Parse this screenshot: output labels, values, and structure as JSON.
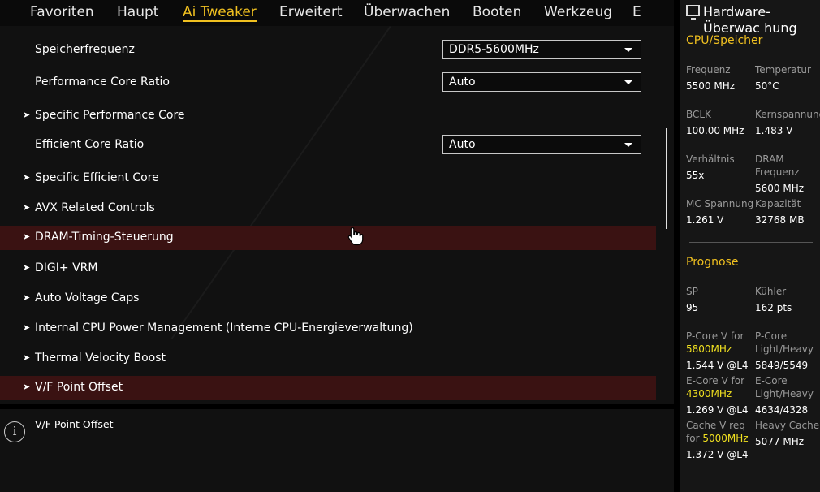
{
  "tabs": [
    {
      "label": "Favoriten"
    },
    {
      "label": "Haupt"
    },
    {
      "label": "Ai Tweaker"
    },
    {
      "label": "Erweitert"
    },
    {
      "label": "Überwachen"
    },
    {
      "label": "Booten"
    },
    {
      "label": "Werkzeug"
    },
    {
      "label": "E"
    }
  ],
  "active_tab": "Ai Tweaker",
  "settings": {
    "memory_freq": {
      "label": "Speicherfrequenz",
      "value": "DDR5-5600MHz"
    },
    "perf_core_ratio": {
      "label": "Performance Core Ratio",
      "value": "Auto"
    },
    "specific_perf_core": {
      "label": "Specific Performance Core"
    },
    "eff_core_ratio": {
      "label": "Efficient Core Ratio",
      "value": "Auto"
    },
    "specific_eff_core": {
      "label": "Specific Efficient Core"
    },
    "avx": {
      "label": "AVX Related Controls"
    },
    "dram_timing": {
      "label": "DRAM-Timing-Steuerung"
    },
    "digi_vrm": {
      "label": "DIGI+ VRM"
    },
    "auto_voltage_caps": {
      "label": "Auto Voltage Caps"
    },
    "internal_cpu_pm": {
      "label": "Internal CPU Power Management (Interne CPU-Energieverwaltung)"
    },
    "thermal_velocity": {
      "label": "Thermal Velocity Boost"
    },
    "vf_point_offset": {
      "label": "V/F Point Offset"
    }
  },
  "help": {
    "text": "V/F Point Offset",
    "icon": "info-icon"
  },
  "hw_monitor": {
    "title": "Hardware-Überwac hung",
    "cpu_mem": {
      "heading": "CPU/Speicher",
      "freq_label": "Frequenz",
      "freq_value": "5500 MHz",
      "temp_label": "Temperatur",
      "temp_value": "50°C",
      "bclk_label": "BCLK",
      "bclk_value": "100.00 MHz",
      "core_v_label": "Kernspannung",
      "core_v_value": "1.483 V",
      "ratio_label": "Verhältnis",
      "ratio_value": "55x",
      "dram_freq_label1": "DRAM",
      "dram_freq_label2": "Frequenz",
      "dram_freq_value": "5600 MHz",
      "mc_v_label": "MC Spannung",
      "mc_v_value": "1.261 V",
      "capacity_label": "Kapazität",
      "capacity_value": "32768 MB"
    },
    "prognose": {
      "heading": "Prognose",
      "sp_label": "SP",
      "sp_value": "95",
      "cooler_label": "Kühler",
      "cooler_value": "162 pts",
      "pcore_v_label": "P-Core V for",
      "pcore_v_freq": "5800MHz",
      "pcore_v_value": "1.544 V @L4",
      "pcore_lh_label1": "P-Core",
      "pcore_lh_label2": "Light/Heavy",
      "pcore_lh_value": "5849/5549",
      "ecore_v_label": "E-Core V for",
      "ecore_v_freq": "4300MHz",
      "ecore_v_value": "1.269 V @L4",
      "ecore_lh_label1": "E-Core",
      "ecore_lh_label2": "Light/Heavy",
      "ecore_lh_value": "4634/4328",
      "cache_v_label1": "Cache V req",
      "cache_v_label2": "for",
      "cache_v_freq": "5000MHz",
      "cache_v_value": "1.372 V @L4",
      "heavy_cache_label": "Heavy Cache",
      "heavy_cache_value": "5077 MHz"
    }
  },
  "colors": {
    "accent": "#f0c020",
    "highlight_row": "#3a1212",
    "value_highlight": "#f0e020"
  }
}
